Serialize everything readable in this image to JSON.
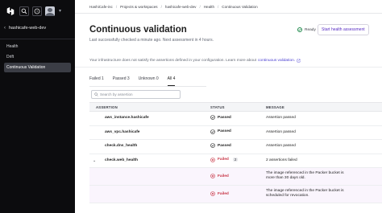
{
  "sidebar": {
    "project_name": "hashicafe-web-dev",
    "nav": [
      {
        "label": "Health"
      },
      {
        "label": "Drift"
      },
      {
        "label": "Continuous Validation"
      }
    ]
  },
  "breadcrumb": {
    "items": [
      "HashiCafe-inc",
      "Projects & workspaces",
      "hashicafe-web-dev",
      "Health",
      "Continuous Validation"
    ]
  },
  "page": {
    "title": "Continuous validation",
    "subtitle": "Last successfully checked a minute ago. Next assessment in 4 hours.",
    "ready_label": "Ready",
    "start_button": "Start health assessment",
    "note_text": "Your infrastructure does not satisfy the assertions defined in your configuration. Learn more about",
    "note_link": "continuous validation.",
    "tabs": [
      {
        "label": "Failed 1"
      },
      {
        "label": "Passed 3"
      },
      {
        "label": "Unknown 0"
      },
      {
        "label": "All 4"
      }
    ],
    "search_placeholder": "Search by assertion"
  },
  "table": {
    "headers": {
      "assertion": "ASSERTION",
      "status": "STATUS",
      "message": "MESSAGE"
    },
    "rows": [
      {
        "assertion": "aws_instance.hashicafe",
        "status": "Passed",
        "message": "Assertion passed"
      },
      {
        "assertion": "aws_vpc.hashicafe",
        "status": "Passed",
        "message": "Assertion passed"
      },
      {
        "assertion": "check.dns_health",
        "status": "Passed",
        "message": "Assertion passed"
      },
      {
        "assertion": "check.web_health",
        "status": "Failed",
        "count": "2",
        "message": "2 assertions failed"
      }
    ],
    "child_rows": [
      {
        "status": "Failed",
        "message": "The image referenced in the Packer bucket is more than 30 days old."
      },
      {
        "status": "Failed",
        "message": "The image referenced in the Packer bucket is scheduled for revocation."
      }
    ]
  },
  "colors": {
    "sidebar_bg": "#0c0c0e",
    "accent": "#5a2ec4",
    "passed": "#1f8a4c",
    "failed": "#c73445"
  }
}
